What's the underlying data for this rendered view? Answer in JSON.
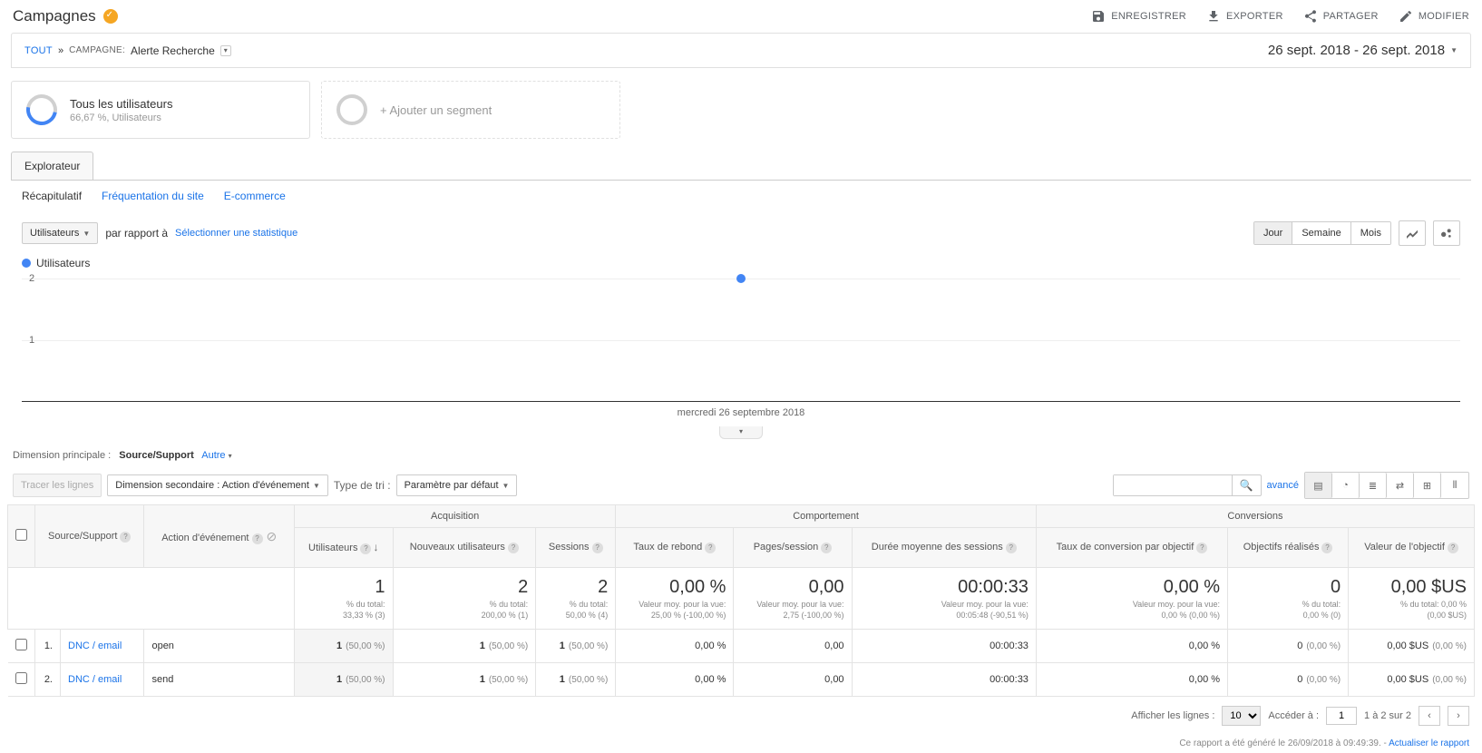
{
  "header": {
    "title": "Campagnes",
    "actions": {
      "save": "ENREGISTRER",
      "export": "EXPORTER",
      "share": "PARTAGER",
      "edit": "MODIFIER"
    }
  },
  "breadcrumb": {
    "all": "TOUT",
    "campaign_label": "CAMPAGNE:",
    "campaign_value": "Alerte Recherche"
  },
  "date_range": "26 sept. 2018 - 26 sept. 2018",
  "segments": {
    "primary": {
      "title": "Tous les utilisateurs",
      "subtitle": "66,67 %, Utilisateurs"
    },
    "add": "+ Ajouter un segment"
  },
  "tabs": {
    "explorer": "Explorateur"
  },
  "subtabs": {
    "recap": "Récapitulatif",
    "freq": "Fréquentation du site",
    "ecom": "E-commerce"
  },
  "controls": {
    "metric_selector": "Utilisateurs",
    "vs_label": "par rapport à",
    "select_stat": "Sélectionner une statistique",
    "granularity": {
      "day": "Jour",
      "week": "Semaine",
      "month": "Mois"
    }
  },
  "chart_data": {
    "type": "scatter",
    "series_name": "Utilisateurs",
    "y_ticks": [
      1,
      2
    ],
    "points": [
      {
        "x_label": "mercredi 26 septembre 2018",
        "y": 2
      }
    ],
    "x_label": "mercredi 26 septembre 2018"
  },
  "dimension_row": {
    "label": "Dimension principale :",
    "primary": "Source/Support",
    "other": "Autre"
  },
  "table_controls": {
    "trace": "Tracer les lignes",
    "secondary_dim": "Dimension secondaire : Action d'événement",
    "sort_label": "Type de tri :",
    "sort_value": "Paramètre par défaut",
    "advanced": "avancé"
  },
  "table": {
    "groups": {
      "acq": "Acquisition",
      "beh": "Comportement",
      "conv": "Conversions"
    },
    "cols": {
      "dim1": "Source/Support",
      "dim2": "Action d'événement",
      "users": "Utilisateurs",
      "newusers": "Nouveaux utilisateurs",
      "sessions": "Sessions",
      "bounce": "Taux de rebond",
      "pages": "Pages/session",
      "duration": "Durée moyenne des sessions",
      "convrate": "Taux de conversion par objectif",
      "goals": "Objectifs réalisés",
      "goalvalue": "Valeur de l'objectif"
    },
    "summary": {
      "users": {
        "v": "1",
        "l1": "% du total:",
        "l2": "33,33 % (3)"
      },
      "newusers": {
        "v": "2",
        "l1": "% du total:",
        "l2": "200,00 % (1)"
      },
      "sessions": {
        "v": "2",
        "l1": "% du total:",
        "l2": "50,00 % (4)"
      },
      "bounce": {
        "v": "0,00 %",
        "l1": "Valeur moy. pour la vue:",
        "l2": "25,00 % (-100,00 %)"
      },
      "pages": {
        "v": "0,00",
        "l1": "Valeur moy. pour la vue:",
        "l2": "2,75 (-100,00 %)"
      },
      "duration": {
        "v": "00:00:33",
        "l1": "Valeur moy. pour la vue:",
        "l2": "00:05:48 (-90,51 %)"
      },
      "convrate": {
        "v": "0,00 %",
        "l1": "Valeur moy. pour la vue:",
        "l2": "0,00 % (0,00 %)"
      },
      "goals": {
        "v": "0",
        "l1": "% du total:",
        "l2": "0,00 % (0)"
      },
      "goalvalue": {
        "v": "0,00 $US",
        "l1": "% du total: 0,00 %",
        "l2": "(0,00 $US)"
      }
    },
    "rows": [
      {
        "n": "1.",
        "dim1": "DNC / email",
        "dim2": "open",
        "users_v": "1",
        "users_p": "(50,00 %)",
        "new_v": "1",
        "new_p": "(50,00 %)",
        "sess_v": "1",
        "sess_p": "(50,00 %)",
        "bounce": "0,00 %",
        "pages": "0,00",
        "dur": "00:00:33",
        "conv": "0,00 %",
        "goals_v": "0",
        "goals_p": "(0,00 %)",
        "gval_v": "0,00 $US",
        "gval_p": "(0,00 %)"
      },
      {
        "n": "2.",
        "dim1": "DNC / email",
        "dim2": "send",
        "users_v": "1",
        "users_p": "(50,00 %)",
        "new_v": "1",
        "new_p": "(50,00 %)",
        "sess_v": "1",
        "sess_p": "(50,00 %)",
        "bounce": "0,00 %",
        "pages": "0,00",
        "dur": "00:00:33",
        "conv": "0,00 %",
        "goals_v": "0",
        "goals_p": "(0,00 %)",
        "gval_v": "0,00 $US",
        "gval_p": "(0,00 %)"
      }
    ]
  },
  "footer": {
    "show_rows": "Afficher les lignes :",
    "rows_value": "10",
    "goto": "Accéder à :",
    "goto_value": "1",
    "range": "1 à 2 sur 2"
  },
  "generated": {
    "text": "Ce rapport a été généré le 26/09/2018 à 09:49:39. - ",
    "link": "Actualiser le rapport"
  }
}
